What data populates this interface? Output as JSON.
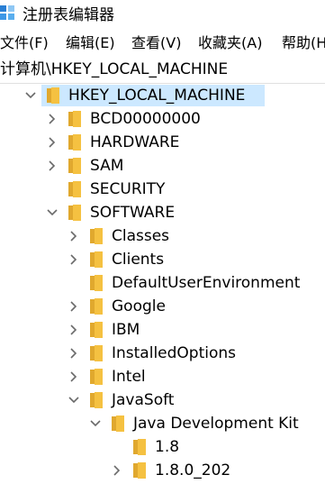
{
  "window": {
    "title": "注册表编辑器",
    "app_icon": "regedit-icon"
  },
  "menu": [
    {
      "label": "文件(F)"
    },
    {
      "label": "编辑(E)"
    },
    {
      "label": "查看(V)"
    },
    {
      "label": "收藏夹(A)"
    },
    {
      "label": "帮助(H)"
    }
  ],
  "address": {
    "path": "计算机\\HKEY_LOCAL_MACHINE"
  },
  "colors": {
    "selection": "#cce8ff",
    "folder": "#f5c141",
    "folder_dark": "#e0a82e",
    "chevron": "#6a6a6a"
  },
  "tree": [
    {
      "label": "HKEY_LOCAL_MACHINE",
      "depth": 0,
      "state": "expanded",
      "selected": true
    },
    {
      "label": "BCD00000000",
      "depth": 1,
      "state": "collapsed"
    },
    {
      "label": "HARDWARE",
      "depth": 1,
      "state": "collapsed"
    },
    {
      "label": "SAM",
      "depth": 1,
      "state": "collapsed"
    },
    {
      "label": "SECURITY",
      "depth": 1,
      "state": "leaf"
    },
    {
      "label": "SOFTWARE",
      "depth": 1,
      "state": "expanded"
    },
    {
      "label": "Classes",
      "depth": 2,
      "state": "collapsed"
    },
    {
      "label": "Clients",
      "depth": 2,
      "state": "collapsed"
    },
    {
      "label": "DefaultUserEnvironment",
      "depth": 2,
      "state": "leaf"
    },
    {
      "label": "Google",
      "depth": 2,
      "state": "collapsed"
    },
    {
      "label": "IBM",
      "depth": 2,
      "state": "collapsed"
    },
    {
      "label": "InstalledOptions",
      "depth": 2,
      "state": "collapsed"
    },
    {
      "label": "Intel",
      "depth": 2,
      "state": "collapsed"
    },
    {
      "label": "JavaSoft",
      "depth": 2,
      "state": "expanded"
    },
    {
      "label": "Java Development Kit",
      "depth": 3,
      "state": "expanded"
    },
    {
      "label": "1.8",
      "depth": 4,
      "state": "leaf"
    },
    {
      "label": "1.8.0_202",
      "depth": 4,
      "state": "collapsed"
    }
  ]
}
